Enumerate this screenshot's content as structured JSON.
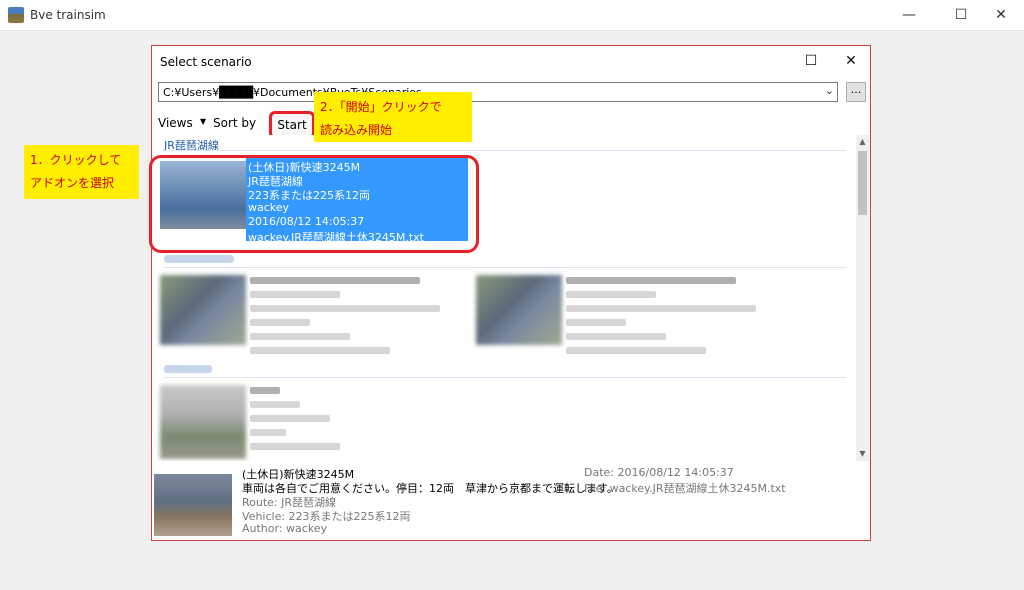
{
  "window": {
    "title": "Bve trainsim",
    "minimize": "—",
    "maximize": "☐",
    "close": "✕"
  },
  "dialog": {
    "title": "Select scenario",
    "maximize": "☐",
    "close": "✕",
    "path": "C:¥Users¥████¥Documents¥BveTs¥Scenarios",
    "path_dropdown": "⌄",
    "browse_label": "...",
    "toolbar": {
      "views_label": "Views",
      "views_arrow": "▼",
      "sortby_label": "Sort by",
      "start_label": "Start"
    },
    "list": {
      "group_header": "JR琵琶湖線",
      "selected": {
        "title": "(土休日)新快速3245M",
        "route": "JR琵琶湖線",
        "vehicle": "223系または225系12両",
        "author": "wackey",
        "date": "2016/08/12 14:05:37",
        "file": "wackey.JR琵琶湖線土休3245M.txt"
      }
    },
    "scroll_up": "▲",
    "scroll_down": "▼",
    "details": {
      "title": "(土休日)新快速3245M",
      "comment": "車両は各自でご用意ください。停目：12両　草津から京都まで運転します。",
      "route": "Route: JR琵琶湖線",
      "vehicle": "Vehicle: 223系または225系12両",
      "author": "Author: wackey",
      "date": "Date: 2016/08/12 14:05:37",
      "file": "File: wackey.JR琵琶湖線土休3245M.txt"
    }
  },
  "annotations": {
    "callout1_line1": "1．クリックして",
    "callout1_line2": "アドオンを選択",
    "callout2_line1": "2．「開始」クリックで",
    "callout2_line2": "読み込み開始"
  },
  "colors": {
    "selection": "#3399ff",
    "highlight": "#e8202a",
    "callout_bg": "#ffee00",
    "callout_text": "#d00000"
  }
}
